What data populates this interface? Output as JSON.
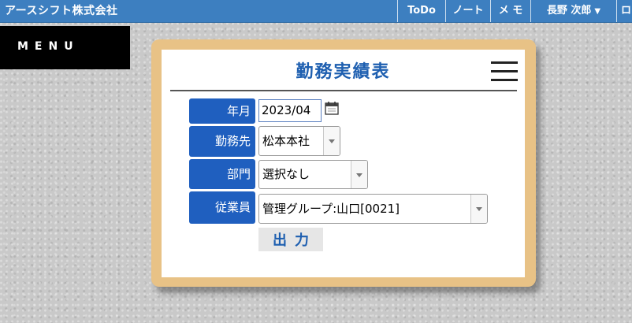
{
  "header": {
    "company": "アースシフト株式会社",
    "nav": {
      "todo": "ToDo",
      "note": "ノート",
      "memo": "メ モ",
      "user": "長野 次郎",
      "extra": "ロ"
    }
  },
  "menu": {
    "label": "MENU"
  },
  "form": {
    "title": "勤務実績表",
    "fields": {
      "year_month_label": "年月",
      "year_month_value": "2023/04",
      "workplace_label": "勤務先",
      "workplace_value": "松本本社",
      "department_label": "部門",
      "department_value": "選択なし",
      "employee_label": "従業員",
      "employee_value": "管理グループ:山口[0021]"
    },
    "output_button": "出力"
  },
  "colors": {
    "topbar": "#3d7fc0",
    "label_bg": "#1f5fbf",
    "title": "#1e5fb0",
    "frame": "#e8c286"
  },
  "icons": [
    "calendar-icon",
    "hamburger-icon",
    "chevron-down-icon"
  ]
}
